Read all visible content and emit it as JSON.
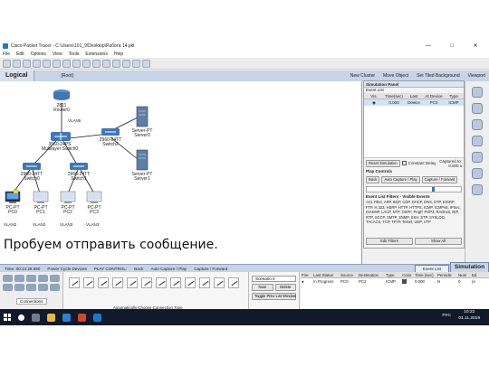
{
  "window": {
    "title": "Cisco Packet Tracer - C:\\Users\\101_9\\Desktop\\Работа 14.pkt",
    "min": "—",
    "max": "□",
    "close": "✕"
  },
  "menu": [
    "File",
    "Edit",
    "Options",
    "View",
    "Tools",
    "Extensions",
    "Help"
  ],
  "workspace_bar": {
    "mode": "Logical",
    "root": "[Root]",
    "new_cluster": "New Cluster",
    "move_object": "Move Object",
    "set_bg": "Set Tiled Background",
    "viewport": "Viewport"
  },
  "topology": {
    "router": {
      "name": "2811",
      "sub": "Router0"
    },
    "multilayer": {
      "name": "3560-24PS",
      "sub": "Multilayer Switch0"
    },
    "switch2": {
      "name": "2960-24TT",
      "sub": "Switch2"
    },
    "switch0": {
      "name": "2960-24TT",
      "sub": "Switch0"
    },
    "switch1": {
      "name": "2960-24TT",
      "sub": "Switch1"
    },
    "server0": {
      "name": "Server-PT",
      "sub": "Server0"
    },
    "server1": {
      "name": "Server-PT",
      "sub": "Server1"
    },
    "pcs": [
      {
        "name": "PC-PT",
        "sub": "PC0",
        "vlan": "VLAN2"
      },
      {
        "name": "PC-PT",
        "sub": "PC1",
        "vlan": "VLAN2"
      },
      {
        "name": "PC-PT",
        "sub": "PC2",
        "vlan": "VLAN3"
      },
      {
        "name": "PC-PT",
        "sub": "PC3",
        "vlan": "VLAN3"
      }
    ],
    "vlan_router": "VLAN5",
    "colors": {
      "link": "#1a1a1a",
      "device": "#3f78b8",
      "server": "#5d7fa6"
    }
  },
  "caption": "Пробуем отправить сообщение.",
  "sim_panel": {
    "title": "Simulation Panel",
    "event_list": "Event List",
    "headers": [
      "Vis.",
      "Time(sec)",
      "Last Device",
      "At Device",
      "Type"
    ],
    "rows": [
      [
        "",
        "0.000",
        "--",
        "PC0",
        "ICMP"
      ]
    ],
    "reset": "Reset Simulation",
    "constant_delay": "Constant Delay",
    "captured_to": "Captured to:",
    "captured_val": "0.000 s",
    "play_controls": "Play Controls",
    "back": "Back",
    "auto_capture": "Auto Capture / Play",
    "capture_forward": "Capture / Forward",
    "filters_label": "Event List Filters - Visible Events",
    "filters_text": "ACL Filter, ARP, BGP, CDP, DHCP, DNS, DTP, EIGRP, FTP, H.323, HSRP, HTTP, HTTPS, ICMP, ICMPv6, IPSec, ISAKMP, LACP, NTP, OSPF, PAgP, POP3, RADIUS, RIP, RTP, SCCP, SMTP, SNMP, SSH, STP, SYSLOG, TACACS, TCP, TFTP, Telnet, UDP, VTP",
    "edit_filters": "Edit Filters",
    "show_all": "Show All"
  },
  "bottom_bar": {
    "time": "Time: 00:14:28.890",
    "power_cycle": "Power Cycle Devices",
    "play_control": "PLAY CONTROL:",
    "back": "Back",
    "auto": "Auto Capture / Play",
    "capture": "Capture / Forward",
    "event_list": "Event List",
    "simulation": "Simulation"
  },
  "device_panel": {
    "connections": "Connections",
    "auto_conn": "Automatically Choose Connection Type"
  },
  "scenario": {
    "value": "Scenario 0",
    "new": "New",
    "delete": "Delete",
    "toggle": "Toggle PDU List Window"
  },
  "pdu_table": {
    "headers": [
      "Fire",
      "Last Status",
      "Source",
      "Destination",
      "Type",
      "Color",
      "Time (sec)",
      "Periodic",
      "Num",
      "Ed"
    ],
    "rows": [
      [
        "●",
        "In Progress",
        "PC0",
        "PC2",
        "ICMP",
        "",
        "0.000",
        "N",
        "0",
        "(e"
      ]
    ]
  },
  "taskbar": {
    "lang": "РУС",
    "time": "10:23",
    "date": "01.11.2019"
  }
}
